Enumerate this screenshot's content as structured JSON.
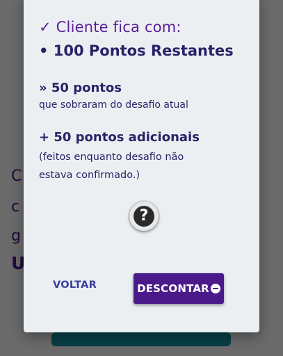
{
  "background": {
    "lines": [
      "C",
      "c",
      "g",
      "U"
    ]
  },
  "dialog": {
    "heading": "✓ Cliente fica com:",
    "total": "• 100 Pontos Restantes",
    "items": [
      {
        "title": "» 50 pontos",
        "desc_lines": [
          "que sobraram do desafio atual"
        ]
      },
      {
        "title": "+ 50 pontos adicionais",
        "desc_lines": [
          "(feitos enquanto desafio não",
          "estava confirmado.)"
        ]
      }
    ],
    "help_icon": "question-mark-icon",
    "back_label": "VOLTAR",
    "confirm_label": "DESCONTAR",
    "confirm_icon": "minus-circle-icon"
  },
  "colors": {
    "primary": "#4a1a8a",
    "heading": "#5a1e96",
    "text": "#2b2166",
    "link": "#3a3e9e",
    "dialog_bg": "#ebeff2"
  }
}
